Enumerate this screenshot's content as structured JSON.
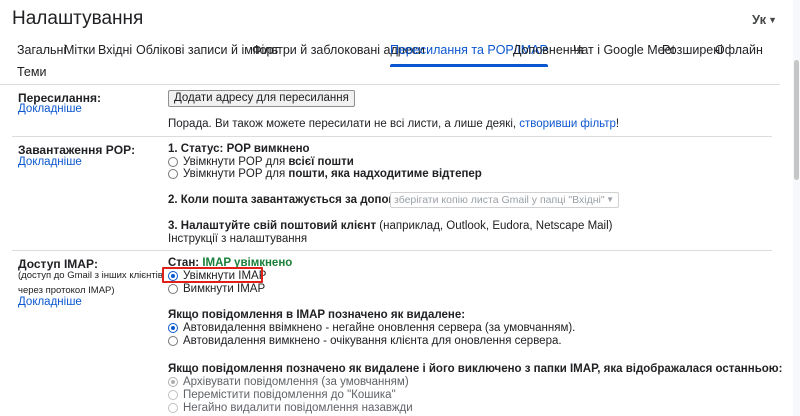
{
  "page": {
    "title": "Налаштування",
    "language": "Ук"
  },
  "tabs": [
    {
      "label": "Загальні",
      "active": false
    },
    {
      "label": "Мітки",
      "active": false
    },
    {
      "label": "Вхідні",
      "active": false
    },
    {
      "label": "Облікові записи й імпорт",
      "active": false
    },
    {
      "label": "Фільтри й заблоковані адреси",
      "active": false
    },
    {
      "label": "Пересилання та POP/IMAP",
      "active": true
    },
    {
      "label": "Доповнення",
      "active": false
    },
    {
      "label": "Чат і Google Meet",
      "active": false
    },
    {
      "label": "Розширені",
      "active": false
    },
    {
      "label": "Офлайн",
      "active": false
    },
    {
      "label": "Теми",
      "active": false
    }
  ],
  "forwarding": {
    "label": "Пересилання:",
    "learn_more": "Докладніше",
    "add_button": "Додати адресу для пересилання",
    "tip_text": "Порада. Ви також можете пересилати не всі листи, а лише деякі, ",
    "tip_link": "створивши фільтр",
    "tip_end": "!"
  },
  "pop": {
    "label": "Завантаження POP:",
    "learn_more": "Докладніше",
    "status_prefix": "1. Статус: ",
    "status_value": "POP вимкнено",
    "option_all_prefix": "Увімкнути POP для ",
    "option_all_bold": "всієї пошти",
    "option_new_prefix": "Увімкнути POP для ",
    "option_new_bold": "пошти, яка надходитиме відтепер",
    "when_label": "2. Коли пошта завантажується за допомогою POP",
    "when_select": "зберігати копію листа Gmail у папці \"Вхідні\"",
    "client_bold": "3. Налаштуйте свій поштовий клієнт",
    "client_rest": " (наприклад, Outlook, Eudora, Netscape Mail)",
    "client_link": "Інструкції з налаштування"
  },
  "imap": {
    "label": "Доступ IMAP:",
    "sublabel": "(доступ до Gmail з інших клієнтів через протокол IMAP)",
    "learn_more": "Докладніше",
    "status_prefix": "Стан: ",
    "status_value": "IMAP увімкнено",
    "enable_option": "Увімкнути IMAP",
    "disable_option": "Вимкнути IMAP",
    "deleted_heading": "Якщо повідомлення в IMAP позначено як видалене:",
    "auto_on": "Автовидалення ввімкнено - негайне оновлення сервера (за умовчанням).",
    "auto_off": "Автовидалення вимкнено - очікування клієнта для оновлення сервера.",
    "expunged_heading": "Якщо повідомлення позначено як видалене і його виключено з папки IMAP, яка відображалася останньою:",
    "archive_option": "Архівувати повідомлення (за умовчанням)",
    "trash_option": "Перемістити повідомлення до \"Кошика\"",
    "delete_option": "Негайно видалити повідомлення назавжди"
  },
  "colors": {
    "accent": "#0b57d0",
    "status_green": "#188038",
    "highlight_red": "#e0201b"
  }
}
